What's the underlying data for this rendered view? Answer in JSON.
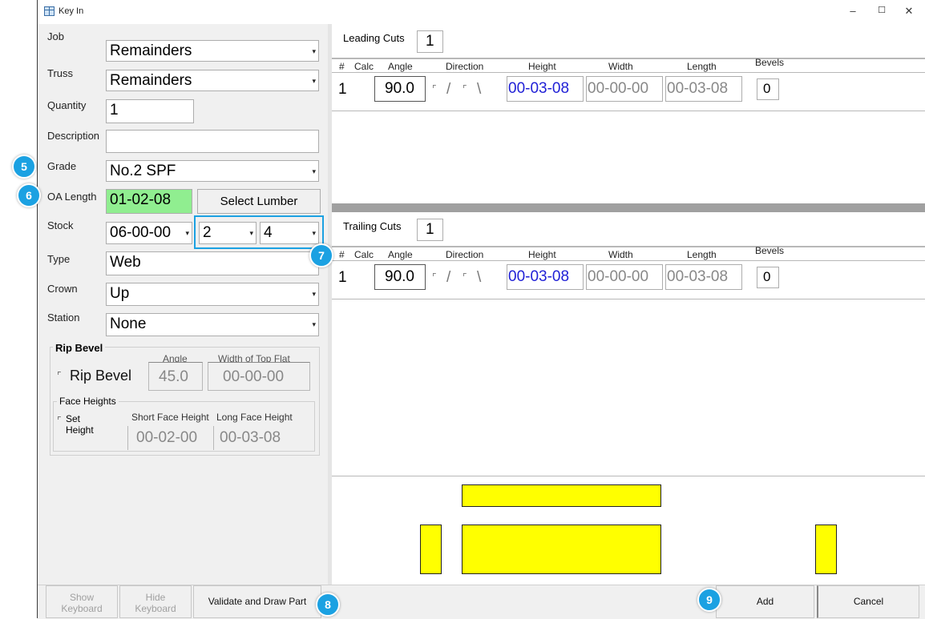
{
  "window": {
    "title": "Key In",
    "min": "–",
    "max": "☐",
    "close": "✕"
  },
  "form": {
    "job": {
      "label": "Job",
      "value": "Remainders"
    },
    "truss": {
      "label": "Truss",
      "value": "Remainders"
    },
    "quantity": {
      "label": "Quantity",
      "value": "1"
    },
    "description": {
      "label": "Description",
      "value": ""
    },
    "grade": {
      "label": "Grade",
      "value": "No.2 SPF"
    },
    "oa_length": {
      "label": "OA Length",
      "value": "01-02-08"
    },
    "select_lumber": "Select Lumber",
    "stock": {
      "label": "Stock",
      "length": "06-00-00",
      "thick": "2",
      "width": "4"
    },
    "type": {
      "label": "Type",
      "value": "Web"
    },
    "crown": {
      "label": "Crown",
      "value": "Up"
    },
    "station": {
      "label": "Station",
      "value": "None"
    }
  },
  "rip_bevel": {
    "group": "Rip Bevel",
    "angle_label": "Angle",
    "width_label": "Width of Top Flat",
    "check_label": "Rip Bevel",
    "angle": "45.0",
    "width": "00-00-00",
    "face_group": "Face Heights",
    "set_label": "Set",
    "height_label": "Height",
    "short_label": "Short Face Height",
    "long_label": "Long Face Height",
    "short": "00-02-00",
    "long": "00-03-08"
  },
  "columns": {
    "num": "#",
    "calc": "Calc",
    "angle": "Angle",
    "direction": "Direction",
    "height": "Height",
    "width": "Width",
    "length": "Length",
    "bevels": "Bevels"
  },
  "leading": {
    "label": "Leading Cuts",
    "count": "1",
    "row": {
      "num": "1",
      "angle": "90.0",
      "slash": "/",
      "backslash": "\\",
      "height": "00-03-08",
      "width": "00-00-00",
      "length": "00-03-08",
      "bevels": "0"
    }
  },
  "trailing": {
    "label": "Trailing Cuts",
    "count": "1",
    "row": {
      "num": "1",
      "angle": "90.0",
      "slash": "/",
      "backslash": "\\",
      "height": "00-03-08",
      "width": "00-00-00",
      "length": "00-03-08",
      "bevels": "0"
    }
  },
  "buttons": {
    "show": "Show",
    "show2": "Keyboard",
    "hide": "Hide",
    "hide2": "Keyboard",
    "validate": "Validate and Draw Part",
    "add": "Add",
    "cancel": "Cancel"
  },
  "badges": {
    "b5": "5",
    "b6": "6",
    "b7": "7",
    "b8": "8",
    "b9": "9"
  },
  "colors": {
    "accent": "#1ba1e2",
    "green_field": "#90ee90",
    "yellow": "#ffff00",
    "blue_text": "#1f1fd6"
  }
}
